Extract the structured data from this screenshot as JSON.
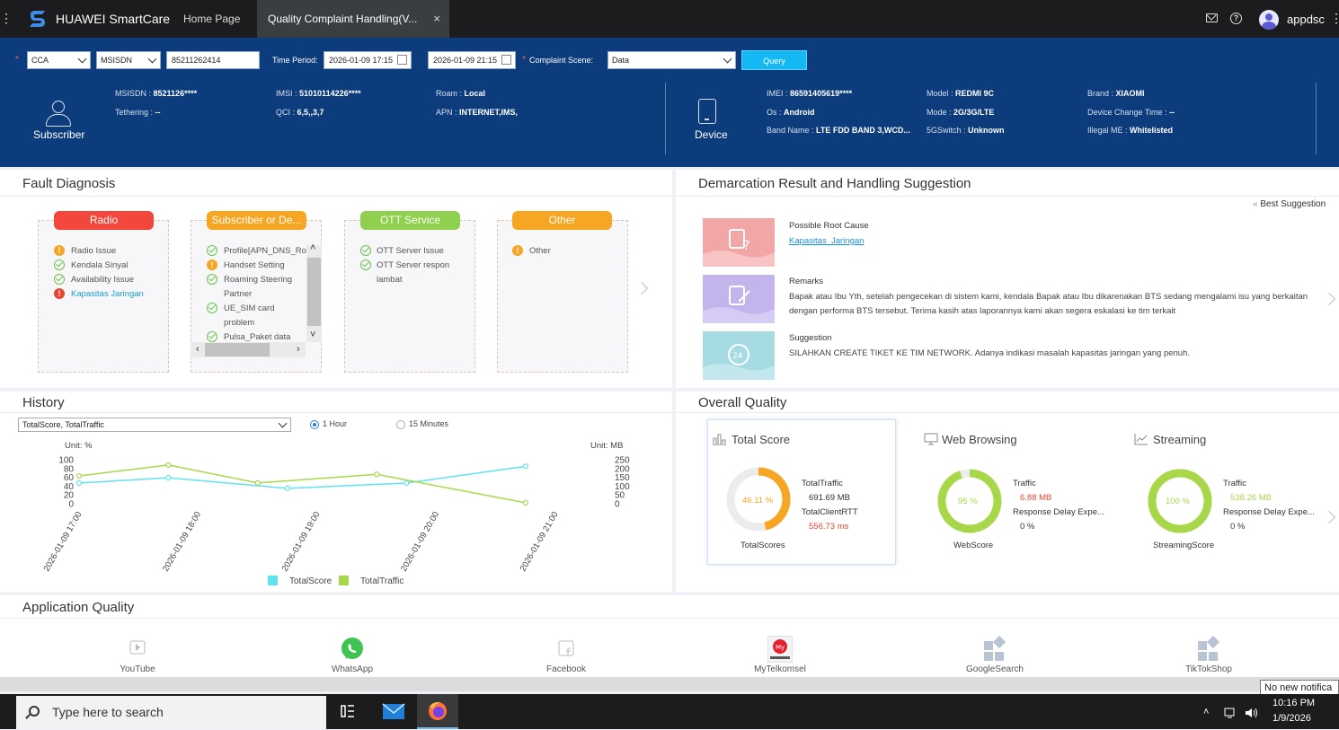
{
  "topbar": {
    "brand": "HUAWEI SmartCare",
    "tabs": [
      {
        "label": "Home Page"
      },
      {
        "label": "Quality Complaint Handling(V..."
      }
    ],
    "close_glyph": "×",
    "username": "appdsc",
    "icons": [
      "menu-icon",
      "mail-icon",
      "help-icon",
      "avatar"
    ]
  },
  "filters": {
    "selector1": "CCA",
    "selector2": "MSISDN",
    "number_value": "85211262414",
    "time_period_label": "Time Period:",
    "start_time": "2026-01-09 17:15",
    "end_time": "2026-01-09 21:15",
    "complaint_scene_label": "Complaint Scene:",
    "complaint_scene_value": "Data",
    "query_label": "Query"
  },
  "subscriber": {
    "label": "Subscriber",
    "fields": [
      {
        "k": "MSISDN",
        "v": "8521126****"
      },
      {
        "k": "Tethering",
        "v": "--"
      },
      {
        "k": "IMSI",
        "v": "51010114226****"
      },
      {
        "k": "QCI",
        "v": "6,5,,3,7"
      },
      {
        "k": "Roam",
        "v": "Local"
      },
      {
        "k": "APN",
        "v": "INTERNET,IMS,"
      }
    ]
  },
  "device": {
    "label": "Device",
    "fields": [
      {
        "k": "IMEI",
        "v": "86591405619****"
      },
      {
        "k": "Os",
        "v": "Android"
      },
      {
        "k": "Band Name",
        "v": "LTE FDD BAND 3,WCD..."
      },
      {
        "k": "Model",
        "v": "REDMI 9C"
      },
      {
        "k": "Mode",
        "v": "2G/3G/LTE"
      },
      {
        "k": "5GSwitch",
        "v": "Unknown"
      },
      {
        "k": "Brand",
        "v": "XIAOMI"
      },
      {
        "k": "Device Change Time",
        "v": "--"
      },
      {
        "k": "Illegal ME",
        "v": "Whitelisted"
      }
    ]
  },
  "fault_diagnosis": {
    "title": "Fault Diagnosis",
    "columns": [
      {
        "name": "Radio",
        "color": "#f2473a",
        "items": [
          {
            "status": "warning",
            "label": "Radio Issue"
          },
          {
            "status": "ok",
            "label": "Kendala Sinyal"
          },
          {
            "status": "ok",
            "label": "Availability Issue"
          },
          {
            "status": "error",
            "label": "Kapasitas Jaringan"
          }
        ]
      },
      {
        "name": "Subscriber or De...",
        "color": "#f6a623",
        "items": [
          {
            "status": "ok",
            "label": "Profile[APN_DNS_Ro"
          },
          {
            "status": "warning",
            "label": "Handset Setting"
          },
          {
            "status": "ok",
            "label": "Roaming Steering"
          },
          {
            "status": "none",
            "label": "Partner"
          },
          {
            "status": "ok",
            "label": "UE_SIM card"
          },
          {
            "status": "none",
            "label": "problem"
          },
          {
            "status": "ok",
            "label": "Pulsa_Paket data"
          }
        ]
      },
      {
        "name": "OTT Service",
        "color": "#8fd14f",
        "items": [
          {
            "status": "ok",
            "label": "OTT Server Issue"
          },
          {
            "status": "ok",
            "label": "OTT Server respon"
          },
          {
            "status": "none",
            "label": "lambat"
          }
        ]
      },
      {
        "name": "Other",
        "color": "#f6a623",
        "items": [
          {
            "status": "warning",
            "label": "Other"
          }
        ]
      }
    ]
  },
  "demarcation": {
    "title": "Demarcation Result and Handling Suggestion",
    "best_suggestion": "Best Suggestion",
    "root_cause_label": "Possible Root Cause",
    "root_cause_value": "Kapasitas_Jaringan",
    "remarks_label": "Remarks",
    "remarks_text": "Bapak atau Ibu Yth, setelah pengecekan di sistem kami, kendala Bapak atau Ibu dikarenakan BTS sedang mengalami isu yang berkaitan dengan performa BTS tersebut. Terima kasih atas laporannya kami akan segera eskalasi ke tim terkait",
    "suggestion_label": "Suggestion",
    "suggestion_text": "SILAHKAN CREATE TIKET KE TIM NETWORK. Adanya indikasi masalah kapasitas jaringan yang penuh.",
    "colors": {
      "root": "#f3a6a6",
      "remarks": "#c3b4ec",
      "suggestion": "#a6dbe3"
    }
  },
  "history": {
    "title": "History",
    "dropdown": "TotalScore, TotalTraffic",
    "radio_1h": "1 Hour",
    "radio_15m": "15 Minutes",
    "chart_data": {
      "type": "line",
      "categories": [
        "2026-01-09 17:00",
        "2026-01-09 18:00",
        "2026-01-09 19:00",
        "2026-01-09 20:00",
        "2026-01-09 21:00"
      ],
      "x": [
        17.0,
        18.0,
        19.0,
        20.0,
        21.0
      ],
      "series": [
        {
          "name": "TotalScore",
          "color": "#5fe3f0",
          "axis": "left",
          "x": [
            17.0,
            17.75,
            18.75,
            19.75,
            20.75
          ],
          "values": [
            47,
            59,
            35,
            47,
            85
          ]
        },
        {
          "name": "TotalTraffic",
          "color": "#a8d84a",
          "axis": "right",
          "x": [
            17.0,
            17.75,
            18.5,
            19.5,
            20.75
          ],
          "values": [
            158,
            220,
            118,
            167,
            5
          ]
        }
      ],
      "ylabel_left": "Unit: %",
      "ylabel_right": "Unit: MB",
      "ylim_left": [
        0,
        100
      ],
      "yticks_left": [
        0,
        20,
        40,
        60,
        80,
        100
      ],
      "ylim_right": [
        0,
        250
      ],
      "yticks_right": [
        0,
        50,
        100,
        150,
        200,
        250
      ],
      "legend": "bottom"
    }
  },
  "overall_quality": {
    "title": "Overall Quality",
    "total": {
      "title": "Total Score",
      "score": "46.11 %",
      "score_fraction": 0.4611,
      "score_label": "TotalScores",
      "traffic_label": "TotalTraffic",
      "traffic_value": "691.69 MB",
      "rtt_label": "TotalClientRTT",
      "rtt_value": "556.73 ms"
    },
    "web": {
      "title": "Web Browsing",
      "score": "95 %",
      "score_fraction": 0.95,
      "score_label": "WebScore",
      "traffic_label": "Traffic",
      "traffic_value": "6.88 MB",
      "delay_label": "Response Delay Expe...",
      "delay_value": "0 %"
    },
    "stream": {
      "title": "Streaming",
      "score": "100 %",
      "score_fraction": 1.0,
      "score_label": "StreamingScore",
      "traffic_label": "Traffic",
      "traffic_value": "538.26 MB",
      "delay_label": "Response Delay Expe...",
      "delay_value": "0 %"
    },
    "colors": {
      "orange": "#f6a623",
      "green": "#a8d84a",
      "red": "#e8452e"
    }
  },
  "app_quality": {
    "title": "Application Quality",
    "apps": [
      "YouTube",
      "WhatsApp",
      "Facebook",
      "MyTelkomsel",
      "GoogleSearch",
      "TikTokShop"
    ]
  },
  "notification": "No new notifica",
  "taskbar": {
    "search_placeholder": "Type here to search",
    "time": "10:16 PM",
    "date": "1/9/2026"
  }
}
